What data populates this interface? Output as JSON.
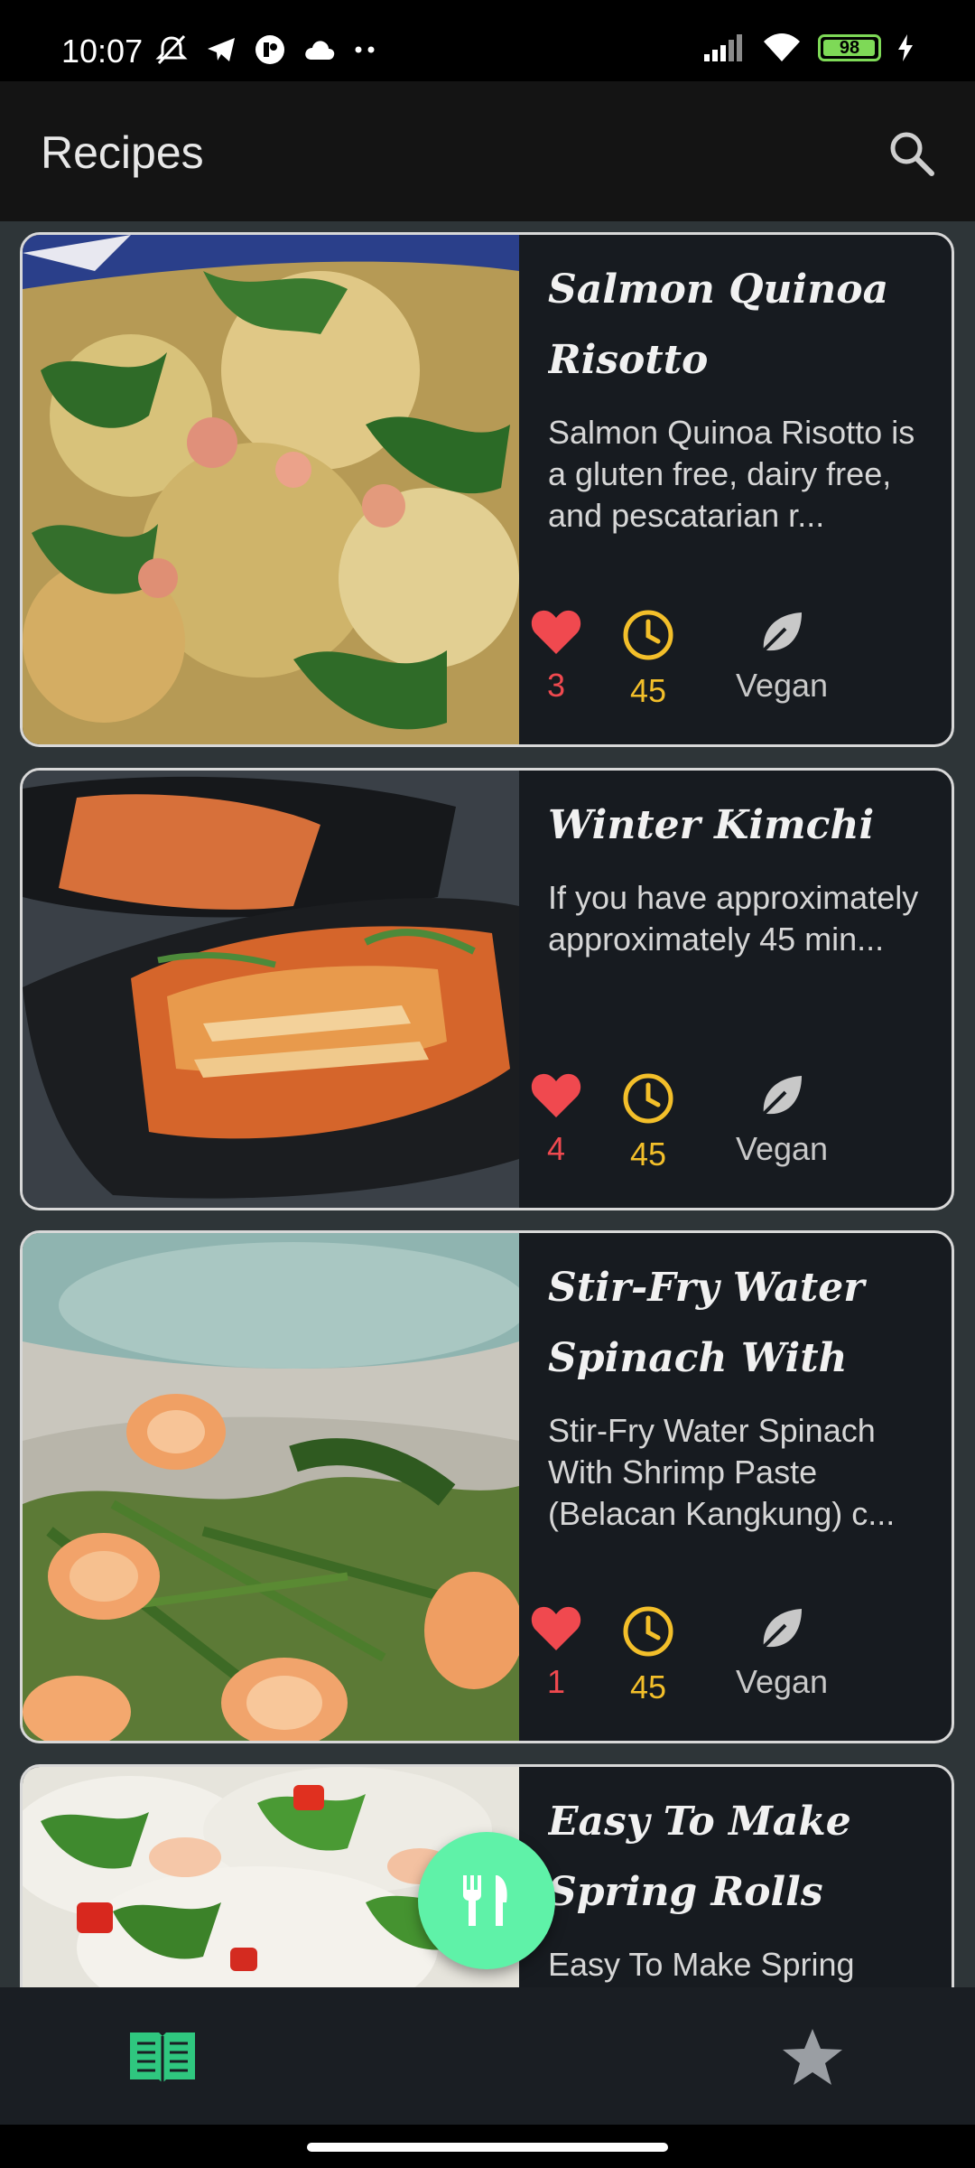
{
  "status_bar": {
    "time": "10:07",
    "battery_level": "98",
    "battery_fraction": 0.98,
    "left_icons": [
      "mute-icon",
      "telegram-icon",
      "app-icon",
      "cloud-icon",
      "more-dots-icon"
    ],
    "right_icons": [
      "signal-icon",
      "wifi-icon",
      "battery-icon",
      "charging-icon"
    ]
  },
  "app_bar": {
    "title": "Recipes",
    "search_icon": "search-icon"
  },
  "recipes": [
    {
      "title": "Salmon Quinoa Risotto",
      "description": "Salmon Quinoa Risotto is a gluten free, dairy free, and pescatarian r...",
      "likes": "3",
      "minutes": "45",
      "tag": "Vegan"
    },
    {
      "title": "Winter Kimchi",
      "description": "If you have approximately approximately 45 min...",
      "likes": "4",
      "minutes": "45",
      "tag": "Vegan"
    },
    {
      "title": "Stir-Fry Water Spinach With Shri...",
      "description": "Stir-Fry Water Spinach With Shrimp Paste (Belacan Kangkung) c...",
      "likes": "1",
      "minutes": "45",
      "tag": "Vegan"
    },
    {
      "title": "Easy To Make Spring Rolls",
      "description": "Easy To Make Spring Rolls...",
      "likes": "",
      "minutes": "",
      "tag": ""
    }
  ],
  "fab": {
    "icon": "fork-knife-icon"
  },
  "bottom_nav": {
    "items": [
      {
        "icon": "book-icon",
        "active": true
      },
      {
        "icon": "star-icon",
        "active": false
      }
    ]
  },
  "colors": {
    "accent": "#5ff2a8",
    "like": "#f0494f",
    "time": "#f3bf2a",
    "app_bar": "#141414",
    "background": "#2e3538",
    "card": "#171b20"
  }
}
